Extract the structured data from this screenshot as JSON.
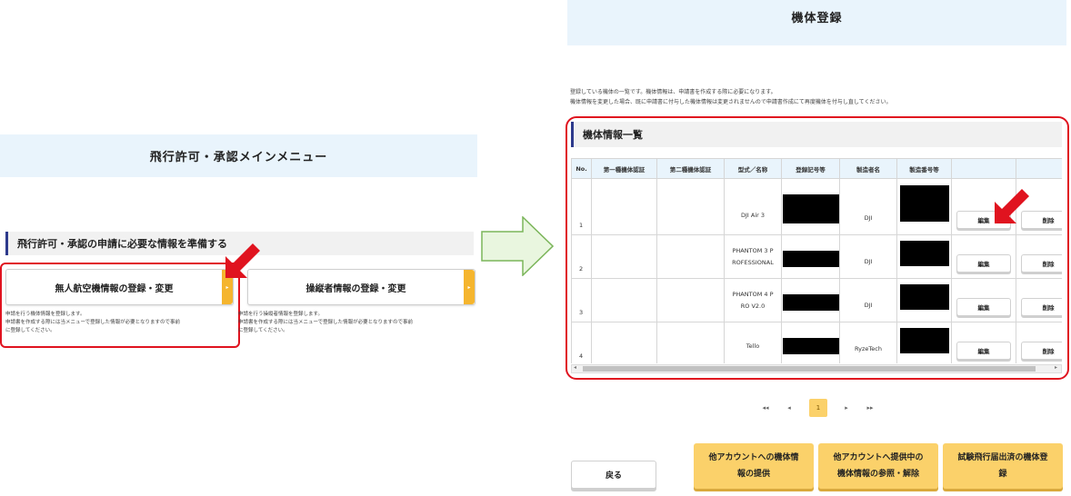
{
  "left_panel": {
    "title": "飛行許可・承認メインメニュー",
    "section_header": "飛行許可・承認の申請に必要な情報を準備する",
    "cards": [
      {
        "label": "無人航空機情報の登録・変更",
        "desc_line1": "申請を行う機体情報を登録します。",
        "desc_line2": "申請書を作成する際には当メニューで登録した情報が必要となりますので事前",
        "desc_line3": "に登録してください。"
      },
      {
        "label": "操縦者情報の登録・変更",
        "desc_line1": "申請を行う操縦者情報を登録します。",
        "desc_line2": "申請書を作成する際には当メニューで登録した情報が必要となりますので事前",
        "desc_line3": "に登録してください。"
      }
    ]
  },
  "right_panel": {
    "title": "機体登録",
    "intro_line1": "登録している機体の一覧です。機体情報は、申請書を作成する際に必要になります。",
    "intro_line2": "機体情報を変更した場合、既に申請書に付与した機体情報は変更されませんので申請書作成にて再度機体を付与し直してください。",
    "section_header": "機体情報一覧",
    "table": {
      "headers": [
        "No.",
        "第一種機体認証",
        "第二種機体認証",
        "型式／名称",
        "登録記号等",
        "製造者名",
        "製造番号等",
        "",
        ""
      ],
      "rows": [
        {
          "no": "1",
          "model": "DJI Air 3",
          "maker": "DJI",
          "edit": "編集",
          "delete": "削除"
        },
        {
          "no": "2",
          "model": "PHANTOM 3 PROFESSIONAL",
          "model_l1": "PHANTOM 3 P",
          "model_l2": "ROFESSIONAL",
          "maker": "DJI",
          "edit": "編集",
          "delete": "削除"
        },
        {
          "no": "3",
          "model": "PHANTOM 4 PRO V2.0",
          "model_l1": "PHANTOM 4 P",
          "model_l2": "RO V2.0",
          "maker": "DJI",
          "edit": "編集",
          "delete": "削除"
        },
        {
          "no": "4",
          "model": "Tello",
          "maker": "RyzeTech",
          "edit": "編集",
          "delete": "削除"
        }
      ]
    },
    "pagination": {
      "first": "◂◂",
      "prev": "◂",
      "current": "1",
      "next": "▸",
      "last": "▸▸"
    },
    "buttons": {
      "back": "戻る",
      "provide_l1": "他アカウントへの機体情",
      "provide_l2": "報の提供",
      "view_l1": "他アカウントへ提供中の",
      "view_l2": "機体情報の参照・解除",
      "register_l1": "試験飛行届出済の機体登",
      "register_l2": "録"
    }
  },
  "icons": {
    "card_tab": "chevron-right-icon",
    "big_arrow": "arrow-right-icon",
    "callout": "red-arrow-icon"
  },
  "colors": {
    "title_bar_bg": "#e9f4fc",
    "accent_yellow": "#fbd16a",
    "highlight_red": "#e0131f",
    "section_border": "#2d3a8c"
  }
}
